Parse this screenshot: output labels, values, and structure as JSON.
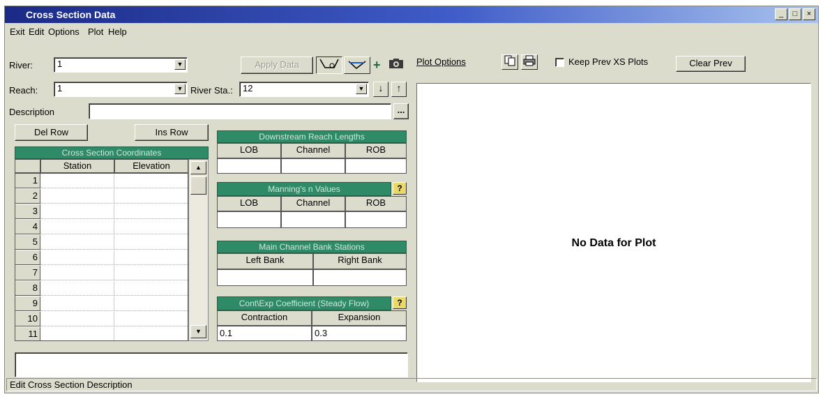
{
  "window": {
    "title": "Cross Section Data",
    "minimize": "_",
    "maximize": "□",
    "close": "×"
  },
  "menu": [
    "Exit",
    "Edit",
    "Options",
    "Plot",
    "Help"
  ],
  "river": {
    "label": "River:",
    "value": "1"
  },
  "reach": {
    "label": "Reach:",
    "value": "1"
  },
  "river_sta": {
    "label": "River Sta.:",
    "value": "12"
  },
  "description": {
    "label": "Description",
    "value": "",
    "browse": "..."
  },
  "toolbar": {
    "apply_data": "Apply Data",
    "plus": "+"
  },
  "rows": {
    "del": "Del Row",
    "ins": "Ins Row"
  },
  "xs_grid": {
    "title": "Cross Section Coordinates",
    "columns": [
      "Station",
      "Elevation"
    ],
    "row_numbers": [
      "1",
      "2",
      "3",
      "4",
      "5",
      "6",
      "7",
      "8",
      "9",
      "10",
      "11"
    ]
  },
  "downstream": {
    "title": "Downstream Reach Lengths",
    "columns": [
      "LOB",
      "Channel",
      "ROB"
    ],
    "values": [
      "",
      "",
      ""
    ]
  },
  "mannings": {
    "title": "Manning's n Values",
    "columns": [
      "LOB",
      "Channel",
      "ROB"
    ],
    "values": [
      "",
      "",
      ""
    ],
    "help": "?"
  },
  "bank": {
    "title": "Main Channel Bank Stations",
    "columns": [
      "Left Bank",
      "Right Bank"
    ],
    "values": [
      "",
      ""
    ]
  },
  "coef": {
    "title": "Cont\\Exp Coefficient (Steady Flow)",
    "columns": [
      "Contraction",
      "Expansion"
    ],
    "values": [
      "0.1",
      "0.3"
    ],
    "help": "?"
  },
  "plot": {
    "options": "Plot Options",
    "keep_prev": "Keep Prev XS Plots",
    "clear_prev": "Clear Prev",
    "message": "No Data for Plot"
  },
  "status": "Edit Cross Section Description",
  "colors": {
    "title_bar": "#1b2a86",
    "header_green": "#2f8a68",
    "window_bg": "#dcdccd"
  }
}
